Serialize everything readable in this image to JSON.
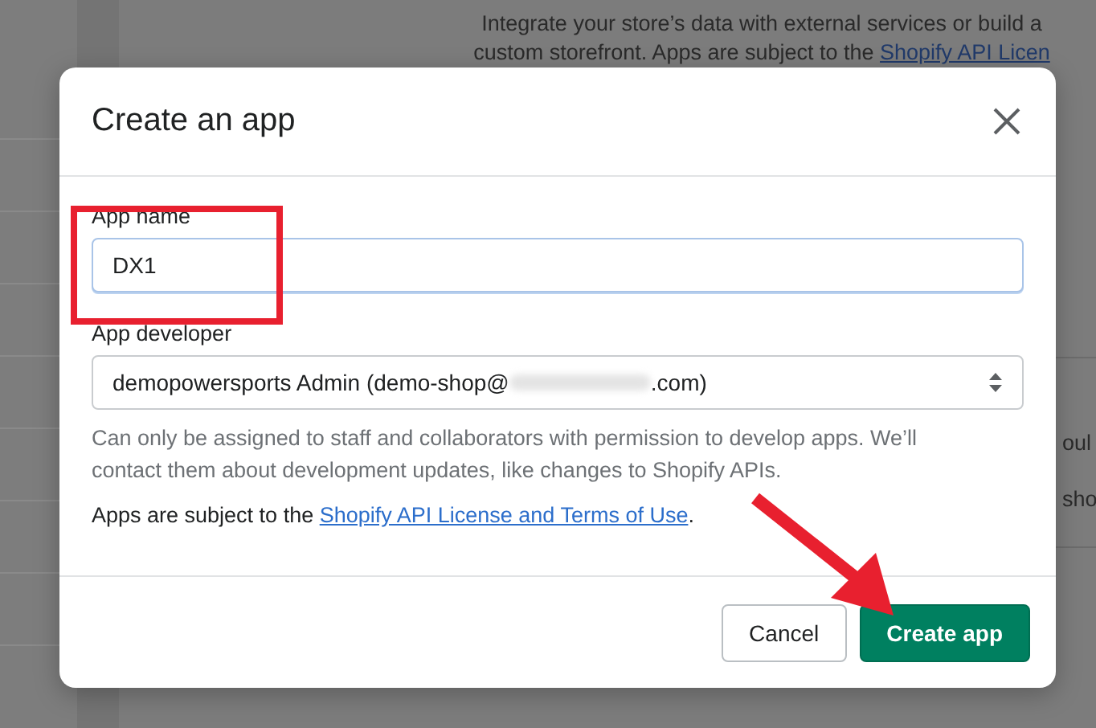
{
  "background": {
    "description_lines": [
      "Integrate your store’s data with external services or build a",
      "custom storefront. Apps are subject to the "
    ],
    "description_link": "Shopify API Licen",
    "side_texts": [
      "oul",
      "sho"
    ]
  },
  "dialog": {
    "title": "Create an app",
    "fields": [
      {
        "kind": "text",
        "label": "App name",
        "value": "DX1",
        "focused": true
      },
      {
        "kind": "select",
        "label": "App developer",
        "value_start": "demopowersports Admin (demo-shop@",
        "value_end": ".com)",
        "help": "Can only be assigned to staff and collaborators with permission to develop apps. We’ll contact them about development updates, like changes to Shopify APIs."
      }
    ],
    "terms": {
      "text": "Apps are subject to the ",
      "link": "Shopify API License and Terms of Use",
      "end": "."
    },
    "buttons": [
      {
        "label": "Cancel",
        "kind": "secondary"
      },
      {
        "label": "Create app",
        "kind": "primary"
      }
    ]
  }
}
